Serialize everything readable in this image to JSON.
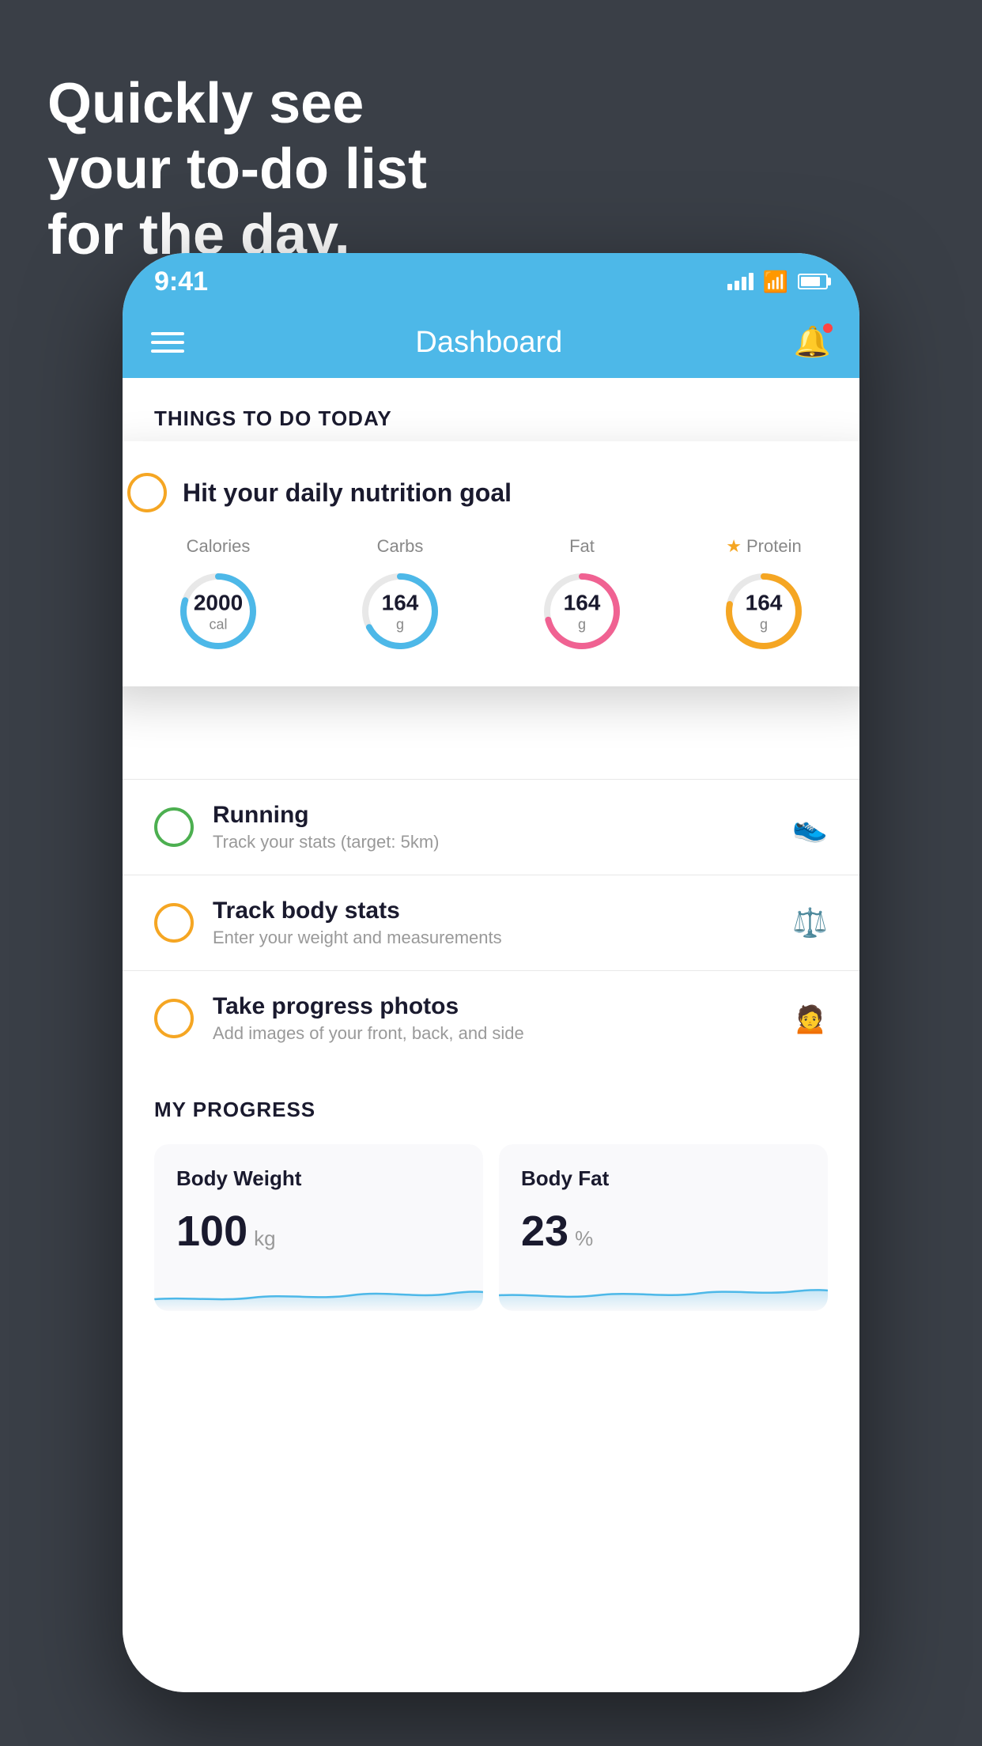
{
  "background": {
    "color": "#3a3f47"
  },
  "headline": {
    "line1": "Quickly see",
    "line2": "your to-do list",
    "line3": "for the day."
  },
  "phone": {
    "status_bar": {
      "time": "9:41"
    },
    "nav": {
      "title": "Dashboard"
    },
    "section_header": "THINGS TO DO TODAY",
    "floating_card": {
      "title": "Hit your daily nutrition goal",
      "nutrients": [
        {
          "label": "Calories",
          "value": "2000",
          "unit": "cal",
          "color": "blue",
          "star": false
        },
        {
          "label": "Carbs",
          "value": "164",
          "unit": "g",
          "color": "blue",
          "star": false
        },
        {
          "label": "Fat",
          "value": "164",
          "unit": "g",
          "color": "pink",
          "star": false
        },
        {
          "label": "Protein",
          "value": "164",
          "unit": "g",
          "color": "gold",
          "star": true
        }
      ]
    },
    "todo_items": [
      {
        "title": "Running",
        "subtitle": "Track your stats (target: 5km)",
        "icon": "shoe",
        "checked": false,
        "circle_color": "green"
      },
      {
        "title": "Track body stats",
        "subtitle": "Enter your weight and measurements",
        "icon": "scale",
        "checked": false,
        "circle_color": "yellow"
      },
      {
        "title": "Take progress photos",
        "subtitle": "Add images of your front, back, and side",
        "icon": "person",
        "checked": false,
        "circle_color": "yellow"
      }
    ],
    "progress": {
      "title": "MY PROGRESS",
      "cards": [
        {
          "title": "Body Weight",
          "value": "100",
          "unit": "kg"
        },
        {
          "title": "Body Fat",
          "value": "23",
          "unit": "%"
        }
      ]
    }
  }
}
